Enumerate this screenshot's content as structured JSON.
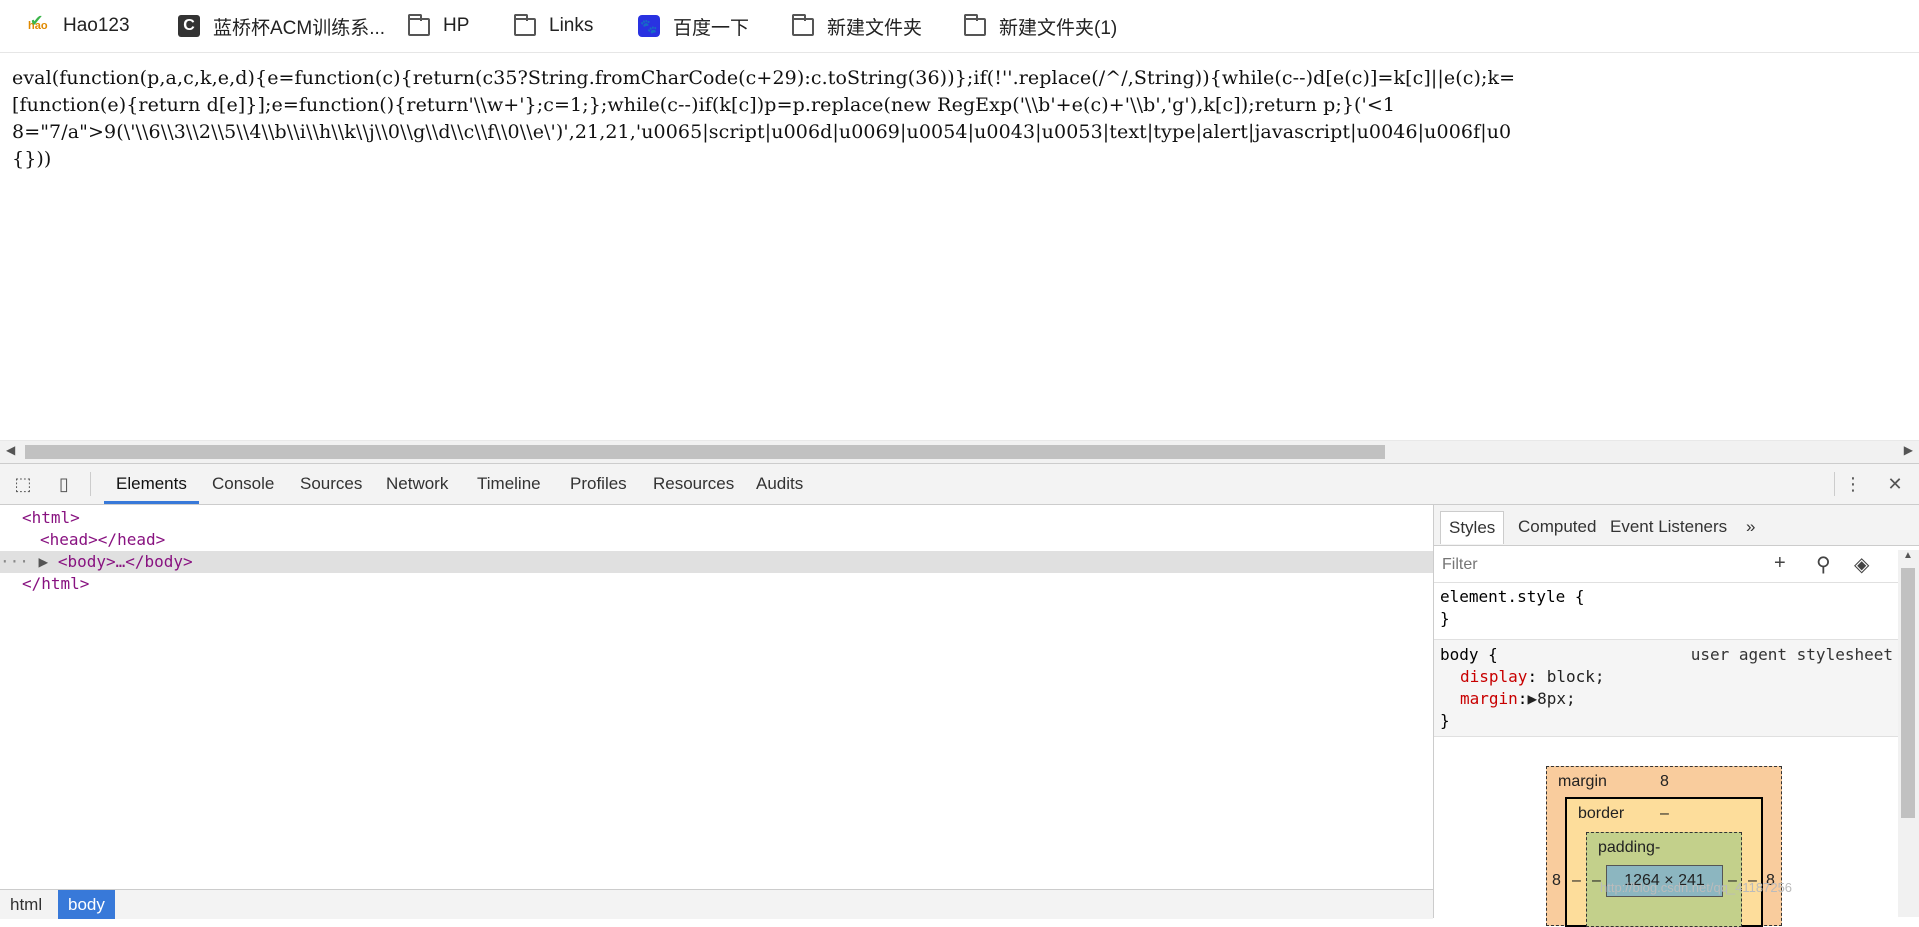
{
  "bookmarks": [
    {
      "label": "Hao123",
      "icon": "hao123-icon"
    },
    {
      "label": "蓝桥杯ACM训练系...",
      "icon": "lanqiao-c-icon"
    },
    {
      "label": "HP",
      "icon": "folder-icon"
    },
    {
      "label": "Links",
      "icon": "folder-icon"
    },
    {
      "label": "百度一下",
      "icon": "baidu-paw-icon"
    },
    {
      "label": "新建文件夹",
      "icon": "folder-icon"
    },
    {
      "label": "新建文件夹(1)",
      "icon": "folder-icon"
    }
  ],
  "page": {
    "code_lines": [
      "eval(function(p,a,c,k,e,d){e=function(c){return(c35?String.fromCharCode(c+29):c.toString(36))};if(!''.replace(/^/,String)){while(c--)d[e(c)]=k[c]||e(c);k=",
      "[function(e){return d[e]}];e=function(){return'\\\\w+'};c=1;};while(c--)if(k[c])p=p.replace(new RegExp('\\\\b'+e(c)+'\\\\b','g'),k[c]);return p;}('<1",
      "8=\"7/a\">9(\\'\\\\6\\\\3\\\\2\\\\5\\\\4\\\\b\\\\i\\\\h\\\\k\\\\j\\\\0\\\\g\\\\d\\\\c\\\\f\\\\0\\\\e\\')',21,21,'u0065|script|u006d|u0069|u0054|u0043|u0053|text|type|alert|javascript|u0046|u006f|u0",
      "{}))"
    ]
  },
  "devtools": {
    "tabs": [
      "Elements",
      "Console",
      "Sources",
      "Network",
      "Timeline",
      "Profiles",
      "Resources",
      "Audits"
    ],
    "active_tab": "Elements",
    "tree": {
      "html_open": "<html>",
      "head": "<head></head>",
      "body": "<body>…</body>",
      "html_close": "</html>"
    },
    "breadcrumbs": [
      "html",
      "body"
    ],
    "styles_tabs": [
      "Styles",
      "Computed",
      "Event Listeners",
      "»"
    ],
    "filter_placeholder": "Filter",
    "element_style": {
      "selector": "element.style {",
      "close": "}"
    },
    "body_rule": {
      "selector": "body {",
      "origin": "user agent stylesheet",
      "props": [
        {
          "name": "display",
          "value": "block;"
        },
        {
          "name": "margin",
          "value": "▶8px;"
        }
      ],
      "close": "}"
    },
    "box_model": {
      "margin_label": "margin",
      "margin_value": "8",
      "border_label": "border",
      "border_value": "–",
      "padding_label": "padding-",
      "content_size": "1264 × 241",
      "left_margin": "8",
      "right_margin": "8",
      "left_border": "–",
      "right_border": "–",
      "left_padding": "–",
      "right_padding": "–"
    },
    "watermark": "http://blog.csdn.net/qq_41187256"
  }
}
